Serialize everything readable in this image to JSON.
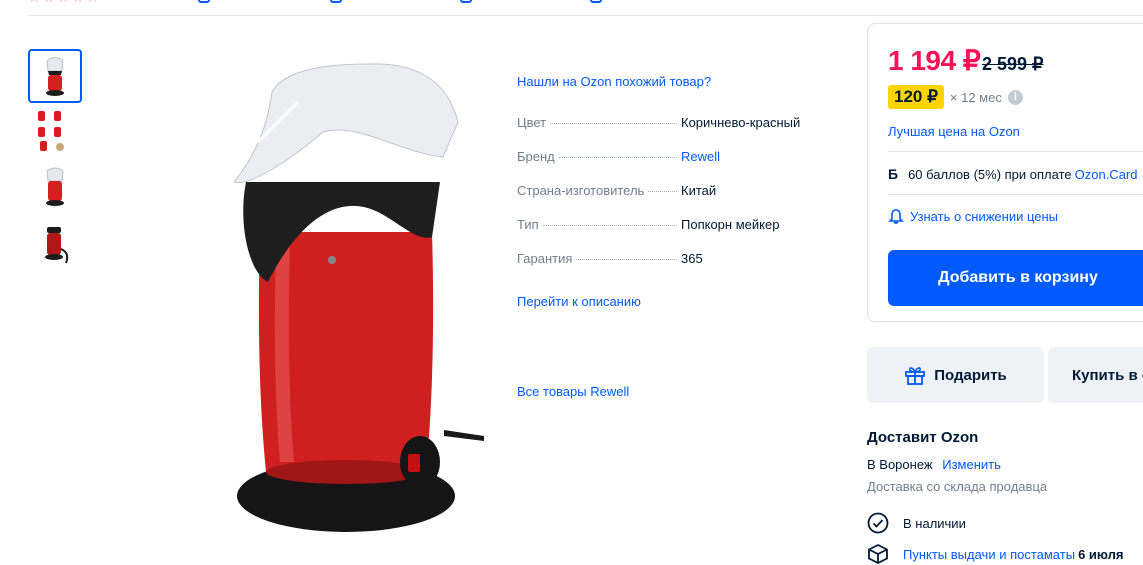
{
  "header": {
    "stars": "☆☆☆☆☆"
  },
  "gallery": {
    "thumbnail_count": 4,
    "colors": {
      "active_border": "#005bff",
      "body_red": "#d42020",
      "base_black": "#1c1c1c"
    }
  },
  "specs": {
    "similar_link": "Нашли на Ozon похожий товар?",
    "rows": [
      {
        "label": "Цвет",
        "value": "Коричнево-красный"
      },
      {
        "label": "Бренд",
        "value": "Rewell"
      },
      {
        "label": "Страна-изготовитель",
        "value": "Китай"
      },
      {
        "label": "Тип",
        "value": "Попкорн мейкер"
      },
      {
        "label": "Гарантия",
        "value": "365"
      }
    ],
    "description_link": "Перейти к описанию",
    "all_brand_link": "Все товары Rewell"
  },
  "price": {
    "current": "1 194 ₽",
    "old": "2 599 ₽",
    "installment_amount": "120 ₽",
    "installment_term": "× 12 мес",
    "info_icon": "i",
    "best_price_link": "Лучшая цена на Ozon",
    "points_icon": "Б",
    "points_text": "60 баллов (5%) при оплате ",
    "points_link": "Ozon.Card",
    "price_alert_link": "Узнать о снижении цены",
    "add_to_cart": "Добавить в корзину",
    "colors": {
      "price": "#f91155",
      "accent": "#005bff",
      "badge": "#ffd400"
    }
  },
  "actions": {
    "gift": "Подарить",
    "buy": "Купить в один клик"
  },
  "delivery": {
    "title": "Доставит Ozon",
    "city": "В Воронеж",
    "change_link": "Изменить",
    "note": "Доставка со склада продавца",
    "in_stock": "В наличии",
    "pickup_link": "Пункты выдачи и постаматы",
    "pickup_date": "6 июля"
  }
}
